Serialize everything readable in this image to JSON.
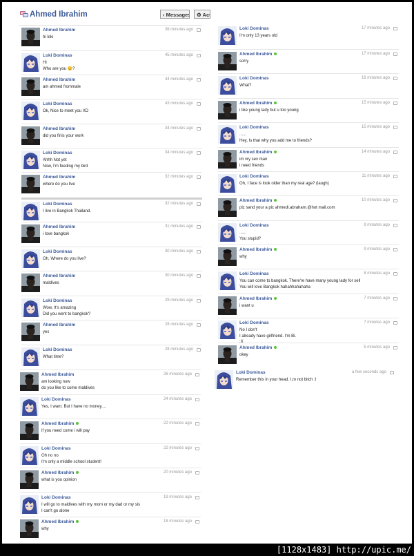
{
  "header": {
    "title": "Ahmed Ibrahim",
    "messages_button": "‹ Messages",
    "actions_button": "⚙ Acti"
  },
  "footer": {
    "stamp": "[1128x1483] http://upic.me/"
  },
  "users": {
    "ahmed": {
      "name": "Ahmed Ibrahim",
      "avatar": "dark-man-avatar"
    },
    "loki": {
      "name": "Loki Dominas",
      "avatar": "blue-hair-anime-avatar"
    }
  },
  "left_messages": [
    {
      "user": "ahmed",
      "name": "Ahmed Ibrahim",
      "time": "36 minutes ago",
      "lines": "hi loki",
      "online": false
    },
    {
      "user": "loki",
      "name": "Loki Dominas",
      "time": "45 minutes ago",
      "lines": "Hi\nWho are you 😊?",
      "online": false
    },
    {
      "user": "ahmed",
      "name": "Ahmed Ibrahim",
      "time": "44 minutes ago",
      "lines": "am ahmed frommale",
      "online": false
    },
    {
      "user": "loki",
      "name": "Loki Dominas",
      "time": "43 minutes ago",
      "lines": "Ok, Nice to meet you XD",
      "online": false
    },
    {
      "user": "ahmed",
      "name": "Ahmed Ibrahim",
      "time": "34 minutes ago",
      "lines": "did you finis your work",
      "online": false
    },
    {
      "user": "loki",
      "name": "Loki Dominas",
      "time": "34 minutes ago",
      "lines": "Ahhh Not yet\nNow, I'm feeding my bird",
      "online": false
    },
    {
      "user": "ahmed",
      "name": "Ahmed Ibrahim",
      "time": "32 minutes ago",
      "lines": "where do you live",
      "online": false
    },
    {
      "user": "loki",
      "name": "Loki Dominas",
      "time": "32 minutes ago",
      "lines": "I live in Bangkok Thailand.",
      "online": false
    },
    {
      "user": "ahmed",
      "name": "Ahmed Ibrahim",
      "time": "31 minutes ago",
      "lines": "i love bangkok",
      "online": false
    },
    {
      "user": "loki",
      "name": "Loki Dominas",
      "time": "30 minutes ago",
      "lines": "Oh, Where do you live?",
      "online": false
    },
    {
      "user": "ahmed",
      "name": "Ahmed Ibrahim",
      "time": "30 minutes ago",
      "lines": "maldives",
      "online": false
    },
    {
      "user": "loki",
      "name": "Loki Dominas",
      "time": "29 minutes ago",
      "lines": "Wow, It's amazing\nDid you went to bangkok?",
      "online": false
    },
    {
      "user": "ahmed",
      "name": "Ahmed Ibrahim",
      "time": "28 minutes ago",
      "lines": "yes",
      "online": false
    },
    {
      "user": "loki",
      "name": "Loki Dominas",
      "time": "28 minutes ago",
      "lines": "What time?",
      "online": false
    },
    {
      "user": "ahmed",
      "name": "Ahmed Ibrahim",
      "time": "26 minutes ago",
      "lines": "am looking now\ndo you like to come maldives",
      "online": false
    },
    {
      "user": "loki",
      "name": "Loki Dominas",
      "time": "24 minutes ago",
      "lines": "Yes, I want. But I have no money....",
      "online": false
    },
    {
      "user": "ahmed",
      "name": "Ahmed Ibrahim",
      "time": "22 minutes ago",
      "lines": "if you need come i will pay",
      "online": true
    },
    {
      "user": "loki",
      "name": "Loki Dominas",
      "time": "22 minutes ago",
      "lines": "Oh no no\nI'm only a middle school student!",
      "online": false
    },
    {
      "user": "ahmed",
      "name": "Ahmed Ibrahim",
      "time": "20 minutes ago",
      "lines": "what is you opinion",
      "online": true
    },
    {
      "user": "loki",
      "name": "Loki Dominas",
      "time": "19 minutes ago",
      "lines": "I will go to maldives with my mom or my dad or my sis\nI can't go alone",
      "online": false
    },
    {
      "user": "ahmed",
      "name": "Ahmed Ibrahim",
      "time": "18 minutes ago",
      "lines": "why",
      "online": true
    }
  ],
  "right_messages": [
    {
      "user": "loki",
      "name": "Loki Dominas",
      "time": "17 minutes ago",
      "lines": "I'm only 13 years old",
      "online": false
    },
    {
      "user": "ahmed",
      "name": "Ahmed Ibrahim",
      "time": "17 minutes ago",
      "lines": "sorry",
      "online": true
    },
    {
      "user": "loki",
      "name": "Loki Dominas",
      "time": "16 minutes ago",
      "lines": "What?",
      "online": false
    },
    {
      "user": "ahmed",
      "name": "Ahmed Ibrahim",
      "time": "15 minutes ago",
      "lines": "i like young lady but u too young",
      "online": true
    },
    {
      "user": "loki",
      "name": "Loki Dominas",
      "time": "15 minutes ago",
      "lines": "......\nHey, Is that why you add me to friends?",
      "online": false
    },
    {
      "user": "ahmed",
      "name": "Ahmed Ibrahim",
      "time": "14 minutes ago",
      "lines": "im vry sex man\ni need friends",
      "online": true
    },
    {
      "user": "loki",
      "name": "Loki Dominas",
      "time": "11 minutes ago",
      "lines": "Oh, I face is look older than my real age? (laugh)",
      "online": false
    },
    {
      "user": "ahmed",
      "name": "Ahmed Ibrahim",
      "time": "10 minutes ago",
      "lines": "plz sand your a pic ahmedi.abraham.@hot mail.com",
      "online": true
    },
    {
      "user": "loki",
      "name": "Loki Dominas",
      "time": "9 minutes ago",
      "lines": "......\nYou stupid?",
      "online": false
    },
    {
      "user": "ahmed",
      "name": "Ahmed Ibrahim",
      "time": "9 minutes ago",
      "lines": "why",
      "online": true
    },
    {
      "user": "loki",
      "name": "Loki Dominas",
      "time": "8 minutes ago",
      "lines": "You can come to bangkok. There're have many young lady for sell\nYou will love Bangkok hahahhahahaha",
      "online": false
    },
    {
      "user": "ahmed",
      "name": "Ahmed Ibrahim",
      "time": "7 minutes ago",
      "lines": "i want u",
      "online": true
    },
    {
      "user": "loki",
      "name": "Loki Dominas",
      "time": "7 minutes ago",
      "lines": "No I don't\nI already have girlfriend. I'm Bi.\n:X",
      "online": false
    },
    {
      "user": "ahmed",
      "name": "Ahmed Ibrahim",
      "time": "5 minutes ago",
      "lines": "okey",
      "online": true
    },
    {
      "user": "loki",
      "name": "Loki Dominas",
      "time": "a few seconds ago",
      "lines": "Remember this in your head. I,m not bitch :I",
      "online": false
    }
  ]
}
